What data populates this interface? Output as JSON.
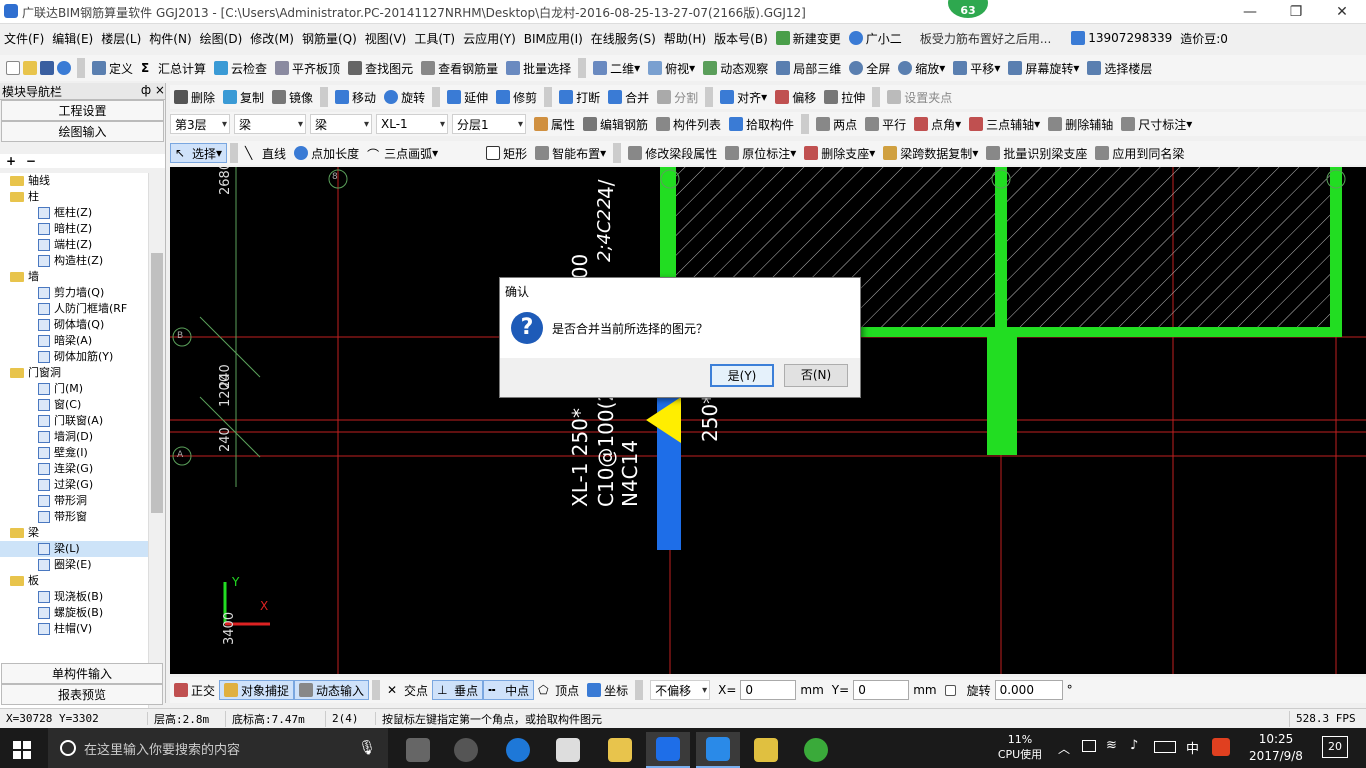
{
  "window": {
    "title": "广联达BIM钢筋算量软件 GGJ2013 - [C:\\Users\\Administrator.PC-20141127NRHM\\Desktop\\白龙村-2016-08-25-13-27-07(2166版).GGJ12]",
    "badge": "63",
    "minimize": "—",
    "maximize": "❐",
    "close": "✕"
  },
  "menu": {
    "items": [
      "文件(F)",
      "编辑(E)",
      "楼层(L)",
      "构件(N)",
      "绘图(D)",
      "修改(M)",
      "钢筋量(Q)",
      "视图(V)",
      "工具(T)",
      "云应用(Y)",
      "BIM应用(I)",
      "在线服务(S)",
      "帮助(H)",
      "版本号(B)",
      "新建变更",
      "广小二"
    ],
    "notice": "板受力筋布置好之后用...",
    "phone": "13907298339",
    "price": "造价豆:0"
  },
  "toolbar1": [
    "定义",
    "汇总计算",
    "云检查",
    "平齐板顶",
    "查找图元",
    "查看钢筋量",
    "批量选择",
    "二维",
    "俯视",
    "动态观察",
    "局部三维",
    "全屏",
    "缩放",
    "平移",
    "屏幕旋转",
    "选择楼层"
  ],
  "toolbar2": [
    "删除",
    "复制",
    "镜像",
    "移动",
    "旋转",
    "延伸",
    "修剪",
    "打断",
    "合并",
    "分割",
    "对齐",
    "偏移",
    "拉伸",
    "设置夹点"
  ],
  "toolbar3": {
    "floor": "第3层",
    "type": "梁",
    "type2": "梁",
    "member": "XL-1",
    "sublayer": "分层1",
    "items": [
      "属性",
      "编辑钢筋",
      "构件列表",
      "拾取构件",
      "两点",
      "平行",
      "点角",
      "三点辅轴",
      "删除辅轴",
      "尺寸标注"
    ]
  },
  "toolbar4": [
    "选择",
    "直线",
    "点加长度",
    "三点画弧",
    "矩形",
    "智能布置",
    "修改梁段属性",
    "原位标注",
    "删除支座",
    "梁跨数据复制",
    "批量识别梁支座",
    "应用到同名梁"
  ],
  "leftpanel": {
    "header": "模块导航栏",
    "pin": "ф ×",
    "btn1": "工程设置",
    "btn2": "绘图输入",
    "tree": [
      {
        "label": "轴线",
        "level": 0,
        "folder": true
      },
      {
        "label": "柱",
        "level": 0,
        "folder": true
      },
      {
        "label": "框柱(Z)",
        "level": 1
      },
      {
        "label": "暗柱(Z)",
        "level": 1
      },
      {
        "label": "端柱(Z)",
        "level": 1
      },
      {
        "label": "构造柱(Z)",
        "level": 1
      },
      {
        "label": "墙",
        "level": 0,
        "folder": true
      },
      {
        "label": "剪力墙(Q)",
        "level": 1
      },
      {
        "label": "人防门框墙(RF",
        "level": 1
      },
      {
        "label": "砌体墙(Q)",
        "level": 1
      },
      {
        "label": "暗梁(A)",
        "level": 1
      },
      {
        "label": "砌体加筋(Y)",
        "level": 1
      },
      {
        "label": "门窗洞",
        "level": 0,
        "folder": true
      },
      {
        "label": "门(M)",
        "level": 1
      },
      {
        "label": "窗(C)",
        "level": 1
      },
      {
        "label": "门联窗(A)",
        "level": 1
      },
      {
        "label": "墙洞(D)",
        "level": 1
      },
      {
        "label": "壁龛(I)",
        "level": 1
      },
      {
        "label": "连梁(G)",
        "level": 1
      },
      {
        "label": "过梁(G)",
        "level": 1
      },
      {
        "label": "带形洞",
        "level": 1
      },
      {
        "label": "带形窗",
        "level": 1
      },
      {
        "label": "梁",
        "level": 0,
        "folder": true
      },
      {
        "label": "梁(L)",
        "level": 1
      },
      {
        "label": "圈梁(E)",
        "level": 1
      },
      {
        "label": "板",
        "level": 0,
        "folder": true
      },
      {
        "label": "现浇板(B)",
        "level": 1
      },
      {
        "label": "螺旋板(B)",
        "level": 1
      },
      {
        "label": "柱帽(V)",
        "level": 1
      }
    ],
    "btn3": "单构件输入",
    "btn4": "报表预览"
  },
  "canvas": {
    "dims": [
      "2680",
      "240",
      "1200",
      "240",
      "250*",
      "250*"
    ],
    "beam_text": [
      "XL-1  250*",
      "C10@100(2",
      "N4C14",
      "4/",
      "2;4C22",
      "800"
    ],
    "axis_labels": [
      "8",
      "B",
      "A",
      "X",
      "Y"
    ],
    "coord": "3400"
  },
  "dialog": {
    "title": "确认",
    "message": "是否合并当前所选择的图元？",
    "yes": "是(Y)",
    "no": "否(N)"
  },
  "snapbar": {
    "items": [
      "正交",
      "对象捕捉",
      "动态输入",
      "交点",
      "垂点",
      "中点",
      "顶点",
      "坐标"
    ],
    "offset": "不偏移",
    "x_label": "X=",
    "x_value": "0",
    "y_label": "Y=",
    "y_value": "0",
    "unit": "mm",
    "rotate_label": "旋转",
    "rotate_value": "0.000",
    "degree": "°"
  },
  "status": {
    "coords": "X=30728 Y=3302",
    "height": "层高:2.8m",
    "base": "底标高:7.47m",
    "count": "2(4)",
    "hint": "按鼠标左键指定第一个角点，或拾取构件图元",
    "fps": "528.3 FPS"
  },
  "taskbar": {
    "search": "在这里输入你要搜索的内容",
    "cpu_percent": "11%",
    "cpu_label": "CPU使用",
    "ime": "中",
    "time": "10:25",
    "date": "2017/9/8",
    "notif": "20"
  }
}
